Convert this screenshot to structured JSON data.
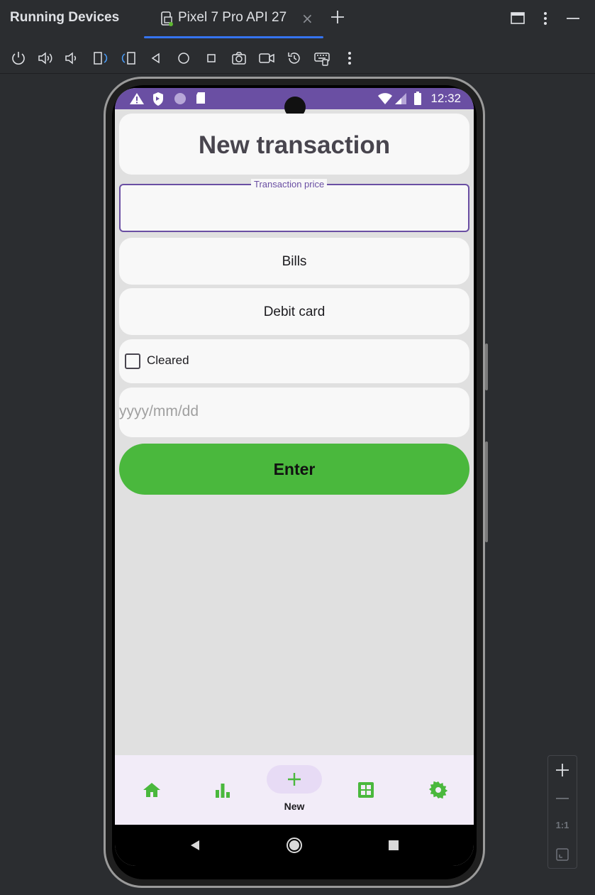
{
  "window": {
    "title": "Running Devices",
    "tab_label": "Pixel 7 Pro API 27",
    "tab_close": "×"
  },
  "toolbar": {
    "items": [
      "power-icon",
      "volume-up-icon",
      "volume-down-icon",
      "rotate-left-icon",
      "rotate-right-icon",
      "back-icon",
      "home-icon",
      "overview-icon",
      "screenshot-icon",
      "screen-record-icon",
      "snapshot-icon",
      "keyboard-icon",
      "more-vert-icon"
    ]
  },
  "status_bar": {
    "time": "12:32",
    "bg_color": "#6a4fa3"
  },
  "app": {
    "heading": "New transaction",
    "price_field_label": "Transaction price",
    "price_value": "",
    "category": "Bills",
    "payment_method": "Debit card",
    "cleared_label": "Cleared",
    "cleared_checked": false,
    "date_placeholder": "yyyy/mm/dd",
    "enter_label": "Enter",
    "accent_color": "#4ab83d"
  },
  "bottom_nav": {
    "items": [
      {
        "icon": "home-icon"
      },
      {
        "icon": "bar-chart-icon"
      },
      {
        "icon": "add-icon",
        "label": "New",
        "selected": true
      },
      {
        "icon": "grid-icon"
      },
      {
        "icon": "settings-icon"
      }
    ],
    "active_label": "New"
  },
  "zoom_controls": {
    "actual_size_label": "1:1"
  }
}
